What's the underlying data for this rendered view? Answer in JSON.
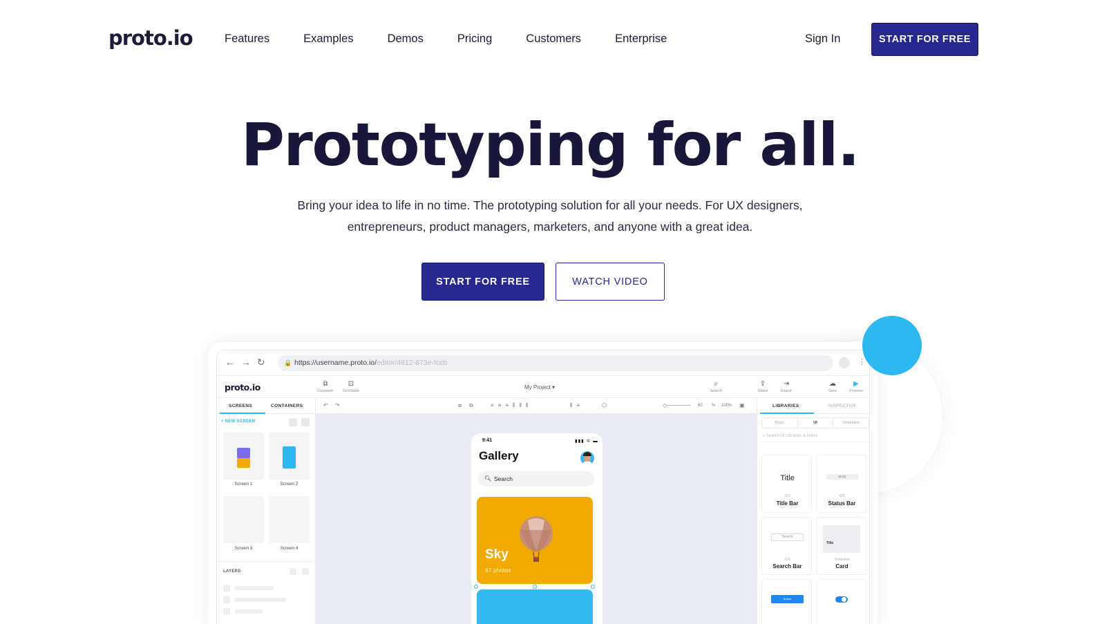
{
  "nav": {
    "logo": "proto.io",
    "links": [
      "Features",
      "Examples",
      "Demos",
      "Pricing",
      "Customers",
      "Enterprise"
    ],
    "sign_in": "Sign In",
    "cta": "START FOR FREE"
  },
  "hero": {
    "title": "Prototyping for all.",
    "subtitle": "Bring your idea to life in no time. The prototyping solution for all your needs. For UX designers, entrepreneurs, product managers, marketers, and anyone with a great idea.",
    "primary_cta": "START FOR FREE",
    "secondary_cta": "WATCH VIDEO"
  },
  "colors": {
    "brand": "#27288f",
    "accent": "#2eb8f0",
    "card_yellow": "#f1ab00"
  },
  "mockup": {
    "url_host": "https://username.proto.io/",
    "url_path": "editor/4612-873e-fccb",
    "app_logo": "proto.io",
    "tools": {
      "container": "Container",
      "scrollable": "Scrollable",
      "search": "Search",
      "share": "Share",
      "export": "Export",
      "save": "Save",
      "preview": "Preview"
    },
    "project_name": "My Project ▾",
    "zoom": {
      "value": "60",
      "unit": "%",
      "full": "100%"
    },
    "left": {
      "tab_screens": "SCREENS",
      "tab_containers": "CONTAINERS",
      "new_screen": "+ NEW SCREEN",
      "screens": [
        "Screen 1",
        "Screen 2",
        "Screen 3",
        "Screen 4"
      ],
      "layers": "LAYERS"
    },
    "phone": {
      "time": "9:41",
      "signal": "▮▮▮ ᯤ ▬",
      "title": "Gallery",
      "search": "Search",
      "card_title": "Sky",
      "card_sub": "67 photos"
    },
    "right": {
      "tab_libraries": "LIBRARIES",
      "tab_inspector": "INSPECTOR",
      "segments": [
        "Basic",
        "UI",
        "Templates"
      ],
      "search_placeholder": "Search UI Libraries & Icons",
      "components": [
        {
          "preview": "Title",
          "platform": "iOS",
          "name": "Title Bar"
        },
        {
          "preview": "16:22",
          "platform": "iOS",
          "name": "Status Bar"
        },
        {
          "preview": "Search",
          "platform": "iOS",
          "name": "Search Bar"
        },
        {
          "preview": "Title",
          "platform": "Templates",
          "name": "Card"
        },
        {
          "preview": "Button",
          "platform": "",
          "name": ""
        },
        {
          "preview": "",
          "platform": "",
          "name": ""
        }
      ]
    }
  }
}
